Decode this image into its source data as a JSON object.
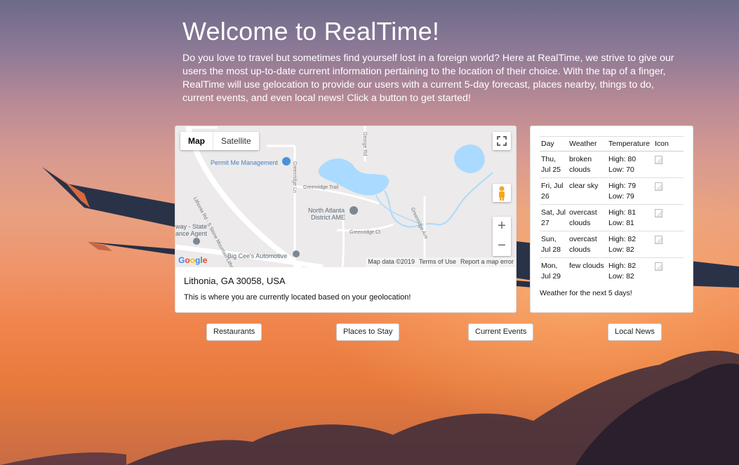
{
  "hero": {
    "title": "Welcome to RealTime!",
    "description": "Do you love to travel but sometimes find yourself lost in a foreign world? Here at RealTime, we strive to give our users the most up-to-date current information pertaining to the location of their choice. With the tap of a finger, RealTime will use gelocation to provide our users with a current 5-day forecast, places nearby, things to do, current events, and even local news! Click a button to get started!"
  },
  "map": {
    "type_options": [
      "Map",
      "Satellite"
    ],
    "selected_type": "Map",
    "zoom_in": "+",
    "zoom_out": "−",
    "logo": "Google",
    "footer": [
      "Map data ©2019",
      "Terms of Use",
      "Report a map error"
    ],
    "labels": {
      "permit": "Permit Me Management",
      "north_atlanta_1": "North Atlanta",
      "north_atlanta_2": "District AME",
      "big_cees": "Big Cee's Automotive",
      "agency_1": "way - State",
      "agency_2": "ance Agent",
      "road_lithonia": "Lithonia Rd · S Stone Mountain Lithonia Rd",
      "road_greenridge_trail": "Greenridge Trail",
      "road_greenridge_ln": "Greenridge Ln",
      "road_greenridge_ct": "Greenridge Ct",
      "road_greenridge_ave": "Greenridge Ave",
      "road_george": "George Rd"
    },
    "location_title": "Lithonia, GA 30058, USA",
    "location_description": "This is where you are currently located based on your geolocation!"
  },
  "weather": {
    "headers": [
      "Day",
      "Weather",
      "Temperature",
      "Icon"
    ],
    "rows": [
      {
        "day": "Thu, Jul 25",
        "weather": "broken clouds",
        "high": "High: 80",
        "low": "Low: 70"
      },
      {
        "day": "Fri, Jul 26",
        "weather": "clear sky",
        "high": "High: 79",
        "low": "Low: 79"
      },
      {
        "day": "Sat, Jul 27",
        "weather": "overcast clouds",
        "high": "High: 81",
        "low": "Low: 81"
      },
      {
        "day": "Sun, Jul 28",
        "weather": "overcast clouds",
        "high": "High: 82",
        "low": "Low: 82"
      },
      {
        "day": "Mon, Jul 29",
        "weather": "few clouds",
        "high": "High: 82",
        "low": "Low: 82"
      }
    ],
    "caption": "Weather for the next 5 days!"
  },
  "buttons": {
    "restaurants": "Restaurants",
    "places_to_stay": "Places to Stay",
    "current_events": "Current Events",
    "local_news": "Local News"
  },
  "colors": {
    "sky_top": "#6d6a88",
    "sky_bottom": "#e87a3c",
    "water": "#aadaff",
    "map_bg": "#eceaea"
  }
}
